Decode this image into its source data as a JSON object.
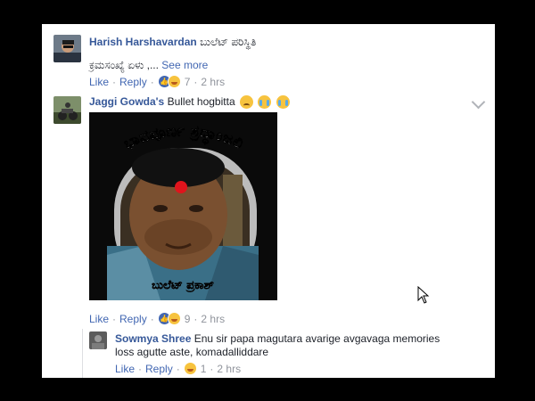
{
  "comments": [
    {
      "author": "Harish Harshavardan",
      "text": "ಬುಲೆಟ್ ಪರಿಸ್ಥಿತಿ",
      "preview": "ಕ್ರಮಸಂಖ್ಯೆ ಏಳು ,...",
      "see_more": "See more",
      "like": "Like",
      "reply": "Reply",
      "reaction_count": "7",
      "time": "2 hrs",
      "sep": "·"
    },
    {
      "author": "Jaggi Gowda's",
      "text": "Bullet hogbitta",
      "photo_top_text": "ಭಾವಪೂರ್ಣ ಶ್ರದ್ಧಾಂಜಲಿ",
      "photo_caption": "ಬುಲೆಟ್ ಪ್ರಕಾಶ್",
      "like": "Like",
      "reply": "Reply",
      "reaction_count": "9",
      "time": "2 hrs",
      "sep": "·"
    }
  ],
  "reply": {
    "author": "Sowmya Shree",
    "text_line1": "Enu sir papa magutara avarige avgavaga memories",
    "text_line2": "loss agutte aste, komadalliddare",
    "like": "Like",
    "reply": "Reply",
    "reaction_count": "1",
    "time": "2 hrs",
    "sep": "·"
  },
  "icons": {
    "like": "thumbs-up-icon",
    "haha": "haha-emoji-icon",
    "sad": "sad-emoji-icon",
    "cry": "crying-emoji-icon",
    "options": "chevron-down-icon",
    "cursor": "mouse-pointer-icon"
  },
  "colors": {
    "link": "#365899",
    "meta": "#90949c",
    "background": "#000000"
  }
}
